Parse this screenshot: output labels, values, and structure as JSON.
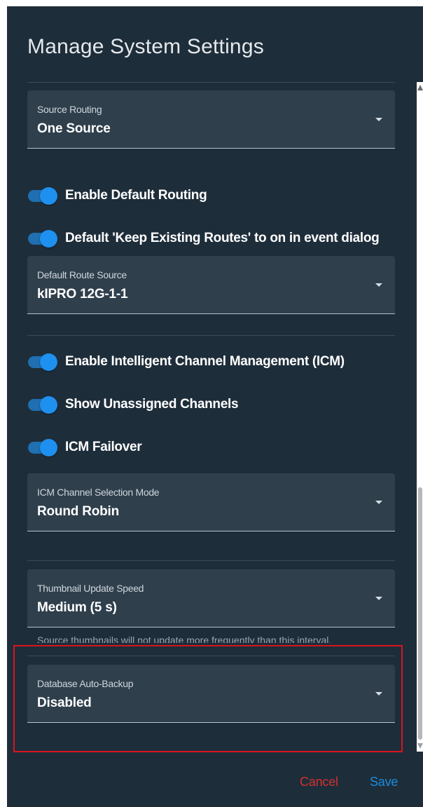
{
  "dialog": {
    "title": "Manage System Settings"
  },
  "source_routing": {
    "label": "Source Routing",
    "value": "One Source"
  },
  "toggles": {
    "enable_default_routing": {
      "label": "Enable Default Routing",
      "checked": true
    },
    "keep_existing_routes": {
      "label": "Default 'Keep Existing Routes' to on in event dialog",
      "checked": true
    },
    "enable_icm": {
      "label": "Enable Intelligent Channel Management (ICM)",
      "checked": true
    },
    "show_unassigned_channels": {
      "label": "Show Unassigned Channels",
      "checked": true
    },
    "icm_failover": {
      "label": "ICM Failover",
      "checked": true
    }
  },
  "default_route_source": {
    "label": "Default Route Source",
    "value": "kIPRO 12G-1-1"
  },
  "icm_channel_selection_mode": {
    "label": "ICM Channel Selection Mode",
    "value": "Round Robin"
  },
  "thumbnail_update_speed": {
    "label": "Thumbnail Update Speed",
    "value": "Medium (5 s)",
    "helper": "Source thumbnails will not update more frequently than this interval."
  },
  "database_auto_backup": {
    "label": "Database Auto-Backup",
    "value": "Disabled"
  },
  "actions": {
    "cancel_label": "Cancel",
    "save_label": "Save"
  },
  "colors": {
    "dialog_background": "#1e2d3a",
    "field_background": "#2f3f4c",
    "toggle_accent": "#1e90ef",
    "cancel": "#d0322f",
    "save": "#1a8cde",
    "highlight_box": "#d7151c"
  },
  "icons": {
    "dropdown": "caret-down-icon",
    "scroll_up": "scroll-up-arrow-icon",
    "scroll_down": "scroll-down-arrow-icon"
  }
}
